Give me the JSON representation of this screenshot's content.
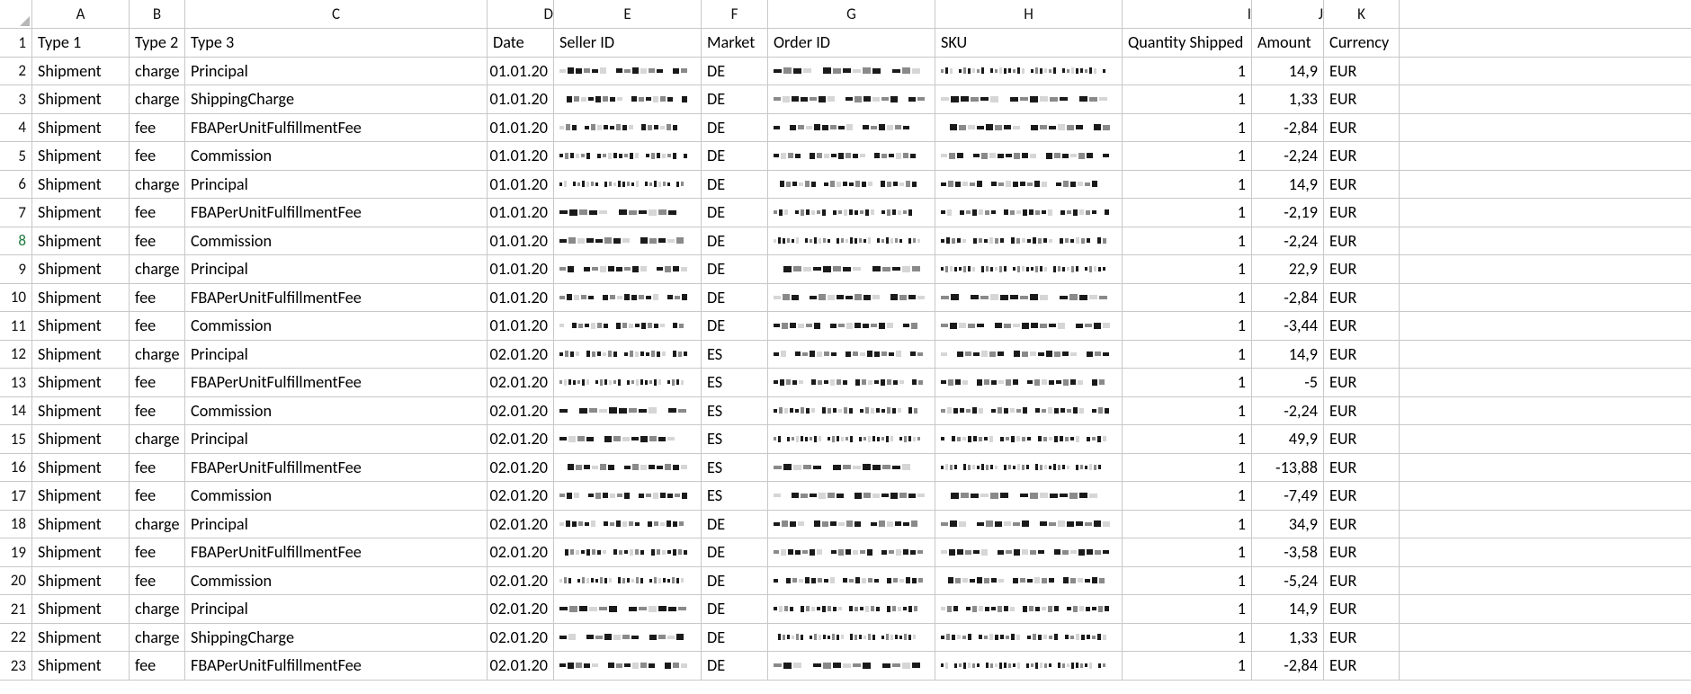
{
  "columns": [
    "A",
    "B",
    "C",
    "D",
    "E",
    "F",
    "G",
    "H",
    "I",
    "J",
    "K"
  ],
  "row_headers": [
    1,
    2,
    3,
    4,
    5,
    6,
    7,
    8,
    9,
    10,
    11,
    12,
    13,
    14,
    15,
    16,
    17,
    18,
    19,
    20,
    21,
    22,
    23
  ],
  "selected_row_header": 8,
  "header_row": {
    "A": "Type 1",
    "B": "Type 2",
    "C": "Type 3",
    "D": "Date",
    "E": "Seller ID",
    "F": "Market",
    "G": "Order ID",
    "H": "SKU",
    "I": "Quantity Shipped",
    "J": "Amount",
    "K": "Currency"
  },
  "rows": [
    {
      "A": "Shipment",
      "B": "charge",
      "C": "Principal",
      "D": "01.01.20",
      "E": "[obscured]",
      "F": "DE",
      "G": "[obscured]",
      "H": "[obscured]",
      "I": "1",
      "J": "14,9",
      "K": "EUR"
    },
    {
      "A": "Shipment",
      "B": "charge",
      "C": "ShippingCharge",
      "D": "01.01.20",
      "E": "[obscured]",
      "F": "DE",
      "G": "[obscured]",
      "H": "[obscured]",
      "I": "1",
      "J": "1,33",
      "K": "EUR"
    },
    {
      "A": "Shipment",
      "B": "fee",
      "C": "FBAPerUnitFulfillmentFee",
      "D": "01.01.20",
      "E": "[obscured]",
      "F": "DE",
      "G": "[obscured]",
      "H": "[obscured]",
      "I": "1",
      "J": "-2,84",
      "K": "EUR"
    },
    {
      "A": "Shipment",
      "B": "fee",
      "C": "Commission",
      "D": "01.01.20",
      "E": "[obscured]",
      "F": "DE",
      "G": "[obscured]",
      "H": "[obscured]",
      "I": "1",
      "J": "-2,24",
      "K": "EUR"
    },
    {
      "A": "Shipment",
      "B": "charge",
      "C": "Principal",
      "D": "01.01.20",
      "E": "[obscured]",
      "F": "DE",
      "G": "[obscured]",
      "H": "[obscured]",
      "I": "1",
      "J": "14,9",
      "K": "EUR"
    },
    {
      "A": "Shipment",
      "B": "fee",
      "C": "FBAPerUnitFulfillmentFee",
      "D": "01.01.20",
      "E": "[obscured]",
      "F": "DE",
      "G": "[obscured]",
      "H": "[obscured]",
      "I": "1",
      "J": "-2,19",
      "K": "EUR"
    },
    {
      "A": "Shipment",
      "B": "fee",
      "C": "Commission",
      "D": "01.01.20",
      "E": "[obscured]",
      "F": "DE",
      "G": "[obscured]",
      "H": "[obscured]",
      "I": "1",
      "J": "-2,24",
      "K": "EUR"
    },
    {
      "A": "Shipment",
      "B": "charge",
      "C": "Principal",
      "D": "01.01.20",
      "E": "[obscured]",
      "F": "DE",
      "G": "[obscured]",
      "H": "[obscured]",
      "I": "1",
      "J": "22,9",
      "K": "EUR"
    },
    {
      "A": "Shipment",
      "B": "fee",
      "C": "FBAPerUnitFulfillmentFee",
      "D": "01.01.20",
      "E": "[obscured]",
      "F": "DE",
      "G": "[obscured]",
      "H": "[obscured]",
      "I": "1",
      "J": "-2,84",
      "K": "EUR"
    },
    {
      "A": "Shipment",
      "B": "fee",
      "C": "Commission",
      "D": "01.01.20",
      "E": "[obscured]",
      "F": "DE",
      "G": "[obscured]",
      "H": "[obscured]",
      "I": "1",
      "J": "-3,44",
      "K": "EUR"
    },
    {
      "A": "Shipment",
      "B": "charge",
      "C": "Principal",
      "D": "02.01.20",
      "E": "[obscured]",
      "F": "ES",
      "G": "[obscured]",
      "H": "[obscured]",
      "I": "1",
      "J": "14,9",
      "K": "EUR"
    },
    {
      "A": "Shipment",
      "B": "fee",
      "C": "FBAPerUnitFulfillmentFee",
      "D": "02.01.20",
      "E": "[obscured]",
      "F": "ES",
      "G": "[obscured]",
      "H": "[obscured]",
      "I": "1",
      "J": "-5",
      "K": "EUR"
    },
    {
      "A": "Shipment",
      "B": "fee",
      "C": "Commission",
      "D": "02.01.20",
      "E": "[obscured]",
      "F": "ES",
      "G": "[obscured]",
      "H": "[obscured]",
      "I": "1",
      "J": "-2,24",
      "K": "EUR"
    },
    {
      "A": "Shipment",
      "B": "charge",
      "C": "Principal",
      "D": "02.01.20",
      "E": "[obscured]",
      "F": "ES",
      "G": "[obscured]",
      "H": "[obscured]",
      "I": "1",
      "J": "49,9",
      "K": "EUR"
    },
    {
      "A": "Shipment",
      "B": "fee",
      "C": "FBAPerUnitFulfillmentFee",
      "D": "02.01.20",
      "E": "[obscured]",
      "F": "ES",
      "G": "[obscured]",
      "H": "[obscured]",
      "I": "1",
      "J": "-13,88",
      "K": "EUR"
    },
    {
      "A": "Shipment",
      "B": "fee",
      "C": "Commission",
      "D": "02.01.20",
      "E": "[obscured]",
      "F": "ES",
      "G": "[obscured]",
      "H": "[obscured]",
      "I": "1",
      "J": "-7,49",
      "K": "EUR"
    },
    {
      "A": "Shipment",
      "B": "charge",
      "C": "Principal",
      "D": "02.01.20",
      "E": "[obscured]",
      "F": "DE",
      "G": "[obscured]",
      "H": "[obscured]",
      "I": "1",
      "J": "34,9",
      "K": "EUR"
    },
    {
      "A": "Shipment",
      "B": "fee",
      "C": "FBAPerUnitFulfillmentFee",
      "D": "02.01.20",
      "E": "[obscured]",
      "F": "DE",
      "G": "[obscured]",
      "H": "[obscured]",
      "I": "1",
      "J": "-3,58",
      "K": "EUR"
    },
    {
      "A": "Shipment",
      "B": "fee",
      "C": "Commission",
      "D": "02.01.20",
      "E": "[obscured]",
      "F": "DE",
      "G": "[obscured]",
      "H": "[obscured]",
      "I": "1",
      "J": "-5,24",
      "K": "EUR"
    },
    {
      "A": "Shipment",
      "B": "charge",
      "C": "Principal",
      "D": "02.01.20",
      "E": "[obscured]",
      "F": "DE",
      "G": "[obscured]",
      "H": "[obscured]",
      "I": "1",
      "J": "14,9",
      "K": "EUR"
    },
    {
      "A": "Shipment",
      "B": "charge",
      "C": "ShippingCharge",
      "D": "02.01.20",
      "E": "[obscured]",
      "F": "DE",
      "G": "[obscured]",
      "H": "[obscured]",
      "I": "1",
      "J": "1,33",
      "K": "EUR"
    },
    {
      "A": "Shipment",
      "B": "fee",
      "C": "FBAPerUnitFulfillmentFee",
      "D": "02.01.20",
      "E": "[obscured]",
      "F": "DE",
      "G": "[obscured]",
      "H": "[obscured]",
      "I": "1",
      "J": "-2,84",
      "K": "EUR"
    }
  ]
}
